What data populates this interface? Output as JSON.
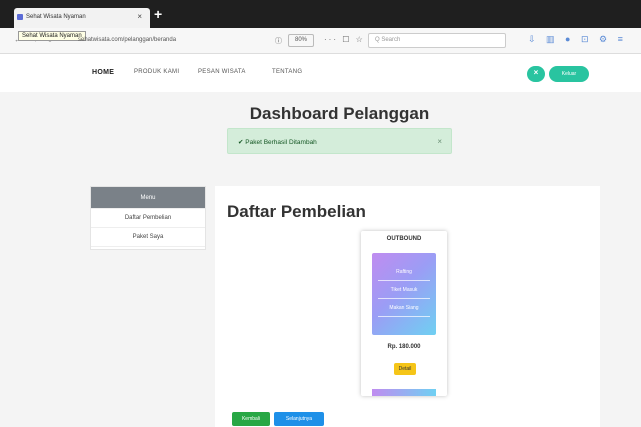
{
  "browser": {
    "tab_title": "Sehat Wisata Nyaman",
    "tab_close": "×",
    "new_tab": "+",
    "tooltip": "Sehat Wisata Nyaman",
    "nav_icons": "← → ↻",
    "url": "sehatwisata.com/pelanggan/beranda",
    "page_action": "ⓘ",
    "zoom": "80%",
    "actions": "··· ☐ ☆",
    "search_placeholder": "Q Search",
    "toolbar_icons": "⇩ ▥ ● ⊡ ⚙ ≡"
  },
  "nav": {
    "home": "HOME",
    "produk": "PRODUK KAMI",
    "pesan": "PESAN WISATA",
    "tentang": "TENTANG",
    "close_symbol": "×",
    "account_label": "Keluar"
  },
  "page": {
    "title": "Dashboard Pelanggan"
  },
  "alert": {
    "icon": "✔",
    "text": "Paket Berhasil Ditambah",
    "close": "×"
  },
  "sidebar": {
    "items": [
      {
        "label": "Menu"
      },
      {
        "label": "Daftar Pembelian"
      },
      {
        "label": "Paket Saya"
      }
    ]
  },
  "main": {
    "title": "Daftar Pembelian",
    "card": {
      "title": "OUTBOUND",
      "features": [
        "Rafting",
        "Tiket Masuk",
        "Makan Siang"
      ],
      "price": "Rp. 180.000",
      "badge": "Detail"
    },
    "buttons": {
      "green": "Kembali",
      "blue": "Selanjutnya"
    }
  }
}
